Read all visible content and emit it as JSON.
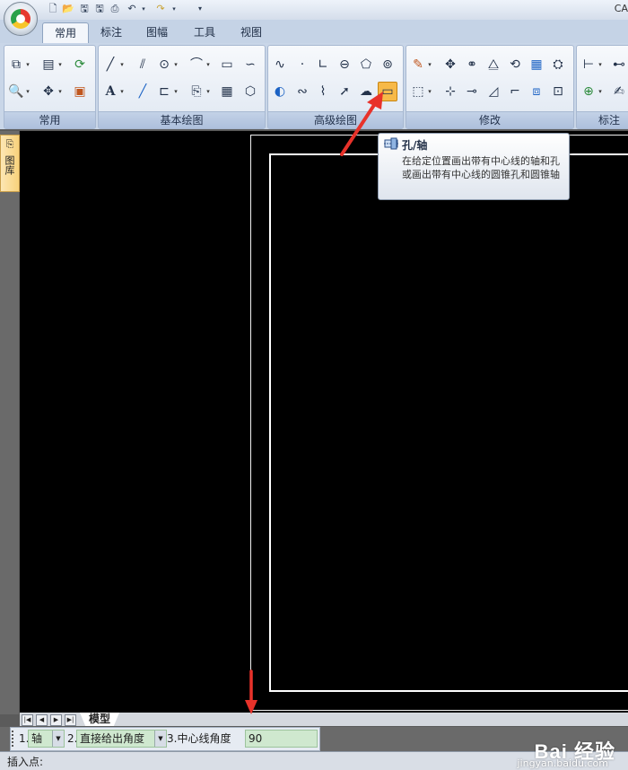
{
  "app": {
    "title": "CA"
  },
  "quick_access": {
    "icons": [
      "new-file-icon",
      "open-folder-icon",
      "save-icon",
      "print-icon",
      "undo-icon",
      "redo-icon",
      "customize-icon"
    ]
  },
  "tabs": [
    {
      "label": "常用",
      "active": true
    },
    {
      "label": "标注",
      "active": false
    },
    {
      "label": "图幅",
      "active": false
    },
    {
      "label": "工具",
      "active": false
    },
    {
      "label": "视图",
      "active": false
    }
  ],
  "ribbon": {
    "groups": [
      {
        "label": "常用"
      },
      {
        "label": "基本绘图"
      },
      {
        "label": "高级绘图"
      },
      {
        "label": "修改"
      },
      {
        "label": "标注"
      }
    ]
  },
  "side_tab": {
    "label": "图库"
  },
  "tooltip": {
    "title": "孔/轴",
    "description": "在给定位置画出带有中心线的轴和孔或画出带有中心线的圆锥孔和圆锥轴"
  },
  "bottom_tabs": {
    "model": "模型"
  },
  "options": {
    "opt1_index": "1.",
    "opt1_value": "轴",
    "opt2_index": "2.",
    "opt2_value": "直接给出角度",
    "opt3_label": "3.中心线角度",
    "opt3_value": "90"
  },
  "status": {
    "prompt": "插入点:"
  },
  "watermark": {
    "brand": "Bai 经验",
    "url": "jingyan.baidu.com"
  },
  "colors": {
    "canvas": "#000000",
    "highlight": "#f7b948",
    "arrow": "#e8322a"
  }
}
